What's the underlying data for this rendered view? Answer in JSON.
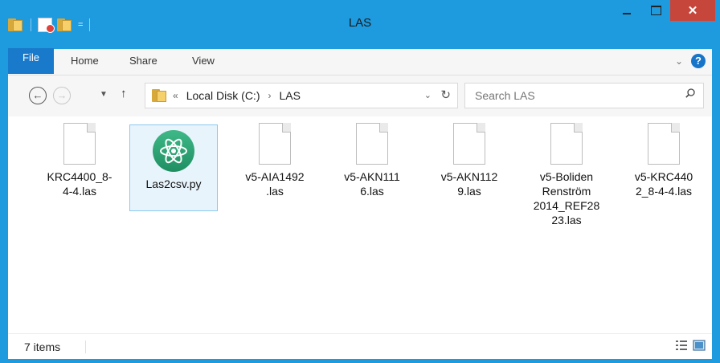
{
  "window": {
    "title": "LAS",
    "close_glyph": "✕",
    "qat_arrow": "=",
    "accent_color": "#1e9ade",
    "close_color": "#c7463c"
  },
  "ribbon": {
    "tabs": [
      {
        "label": "File"
      },
      {
        "label": "Home"
      },
      {
        "label": "Share"
      },
      {
        "label": "View"
      }
    ],
    "expand_glyph": "⌄",
    "help_glyph": "?"
  },
  "navigation": {
    "back_glyph": "←",
    "forward_glyph": "→",
    "recent_glyph": "▼",
    "up_glyph": "↑",
    "breadcrumb_prefix": "«",
    "breadcrumb_separator": "›",
    "breadcrumb": [
      "Local Disk (C:)",
      "LAS"
    ],
    "address_dropdown_glyph": "⌄",
    "refresh_glyph": "↻",
    "search_placeholder": "Search LAS"
  },
  "files": [
    {
      "name": "KRC4400_8-4-4.las",
      "display": "KRC4400_8-\n4-4.las",
      "icon": "document-icon"
    },
    {
      "name": "Las2csv.py",
      "display": "Las2csv.py",
      "icon": "atom-icon",
      "selected": true
    },
    {
      "name": "v5-AIA1492.las",
      "display": "v5-AIA1492\n.las",
      "icon": "document-icon"
    },
    {
      "name": "v5-AKN1116.las",
      "display": "v5-AKN111\n6.las",
      "icon": "document-icon"
    },
    {
      "name": "v5-AKN1129.las",
      "display": "v5-AKN112\n9.las",
      "icon": "document-icon"
    },
    {
      "name": "v5-Boliden Renström 2014_REF2823.las",
      "display": "v5-Boliden\nRenström\n2014_REF28\n23.las",
      "icon": "document-icon"
    },
    {
      "name": "v5-KRC4402_8-4-4.las",
      "display": "v5-KRC440\n2_8-4-4.las",
      "icon": "document-icon"
    }
  ],
  "status": {
    "item_count": "7 items"
  }
}
